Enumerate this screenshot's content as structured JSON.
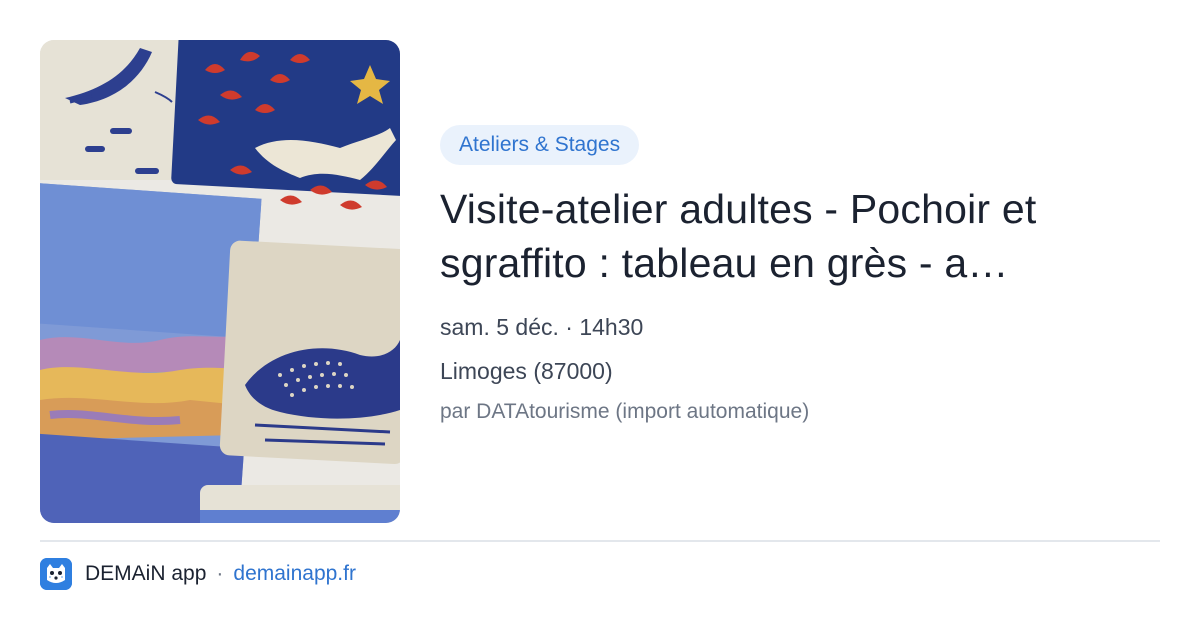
{
  "card": {
    "category": "Ateliers & Stages",
    "title": "Visite-atelier adultes - Pochoir et sgraffito : tableau en grès - a…",
    "date": "sam. 5 déc. · 14h30",
    "place": "Limoges (87000)",
    "source": "par DATAtourisme (import automatique)"
  },
  "footer": {
    "app_name": "DEMAiN app",
    "separator": "·",
    "domain": "demainapp.fr"
  },
  "icons": {
    "app_logo": "demain-app-logo-icon"
  },
  "colors": {
    "accent": "#2f74cf",
    "tag_background": "#eaf2fc",
    "title_text": "#1b2230",
    "meta_text": "#3d4656",
    "source_text": "#6d7685",
    "divider": "#e3e7ec",
    "logo_background": "#2f7fe0"
  }
}
